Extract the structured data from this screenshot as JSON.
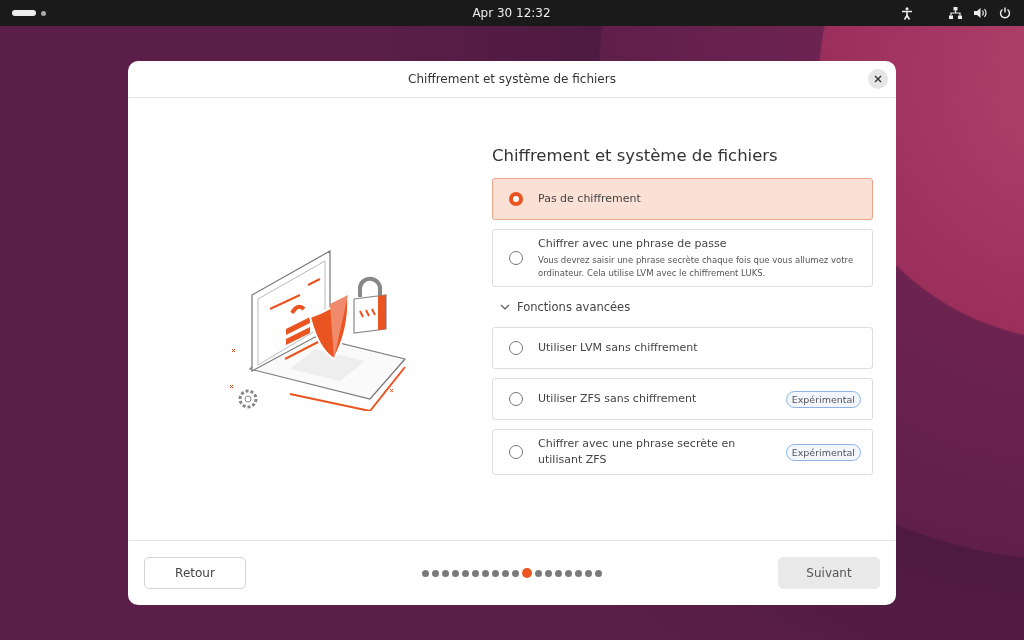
{
  "top_bar": {
    "clock": "Apr 30  12:32"
  },
  "dialog": {
    "title": "Chiffrement et système de fichiers"
  },
  "heading": "Chiffrement et système de fichiers",
  "options": [
    {
      "label": "Pas de chiffrement",
      "selected": true
    },
    {
      "label": "Chiffrer avec une phrase de passe",
      "description": "Vous devrez saisir une phrase secrète chaque fois que vous allumez votre ordinateur. Cela utilise LVM avec le chiffrement LUKS.",
      "selected": false
    }
  ],
  "advanced": {
    "label": "Fonctions avancées",
    "expanded": true,
    "options": [
      {
        "label": "Utiliser LVM sans chiffrement",
        "selected": false
      },
      {
        "label": "Utiliser ZFS sans chiffrement",
        "badge": "Expérimental",
        "selected": false
      },
      {
        "label": "Chiffrer avec une phrase secrète en utilisant ZFS",
        "badge": "Expérimental",
        "selected": false
      }
    ]
  },
  "footer": {
    "back": "Retour",
    "next": "Suivant"
  },
  "steps": [
    {
      "selected": false
    },
    {
      "selected": false
    },
    {
      "selected": false
    },
    {
      "selected": false
    },
    {
      "selected": false
    },
    {
      "selected": false
    },
    {
      "selected": false
    },
    {
      "selected": false
    },
    {
      "selected": false
    },
    {
      "selected": false
    },
    {
      "selected": true
    },
    {
      "selected": false
    },
    {
      "selected": false
    },
    {
      "selected": false
    },
    {
      "selected": false
    },
    {
      "selected": false
    },
    {
      "selected": false
    },
    {
      "selected": false
    }
  ]
}
